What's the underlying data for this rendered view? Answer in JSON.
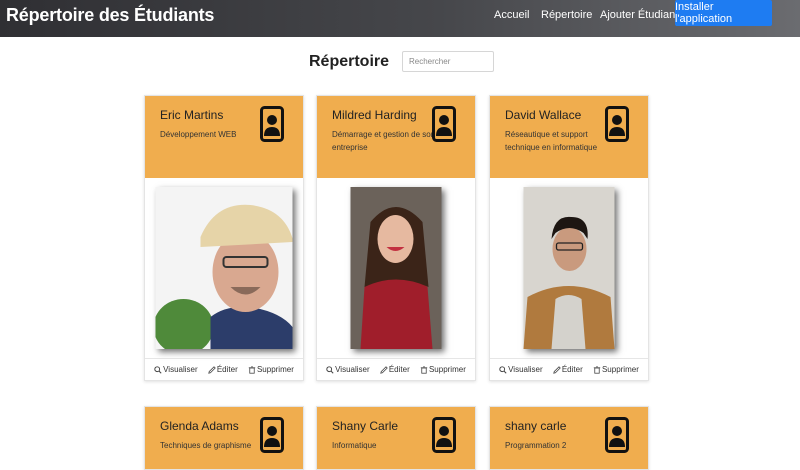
{
  "nav": {
    "brand": "Répertoire des Étudiants",
    "links": [
      "Accueil",
      "Répertoire",
      "Ajouter Étudiant"
    ],
    "install": "Installer l'application"
  },
  "main": {
    "title": "Répertoire",
    "search_placeholder": "Rechercher"
  },
  "actions": {
    "view": "Visualiser",
    "edit": "Éditer",
    "delete": "Supprimer"
  },
  "students": [
    {
      "name": "Eric Martins",
      "program": "Développement WEB"
    },
    {
      "name": "Mildred Harding",
      "program": "Démarrage et gestion de son entreprise"
    },
    {
      "name": "David Wallace",
      "program": "Réseautique et support technique en informatique"
    },
    {
      "name": "Glenda Adams",
      "program": "Techniques de graphisme"
    },
    {
      "name": "Shany Carle",
      "program": "Informatique"
    },
    {
      "name": "shany carle",
      "program": "Programmation 2"
    }
  ],
  "colors": {
    "card_header": "#f0ad4e",
    "install_button": "#1e7cf2",
    "navbar": "#3a3b3f"
  }
}
